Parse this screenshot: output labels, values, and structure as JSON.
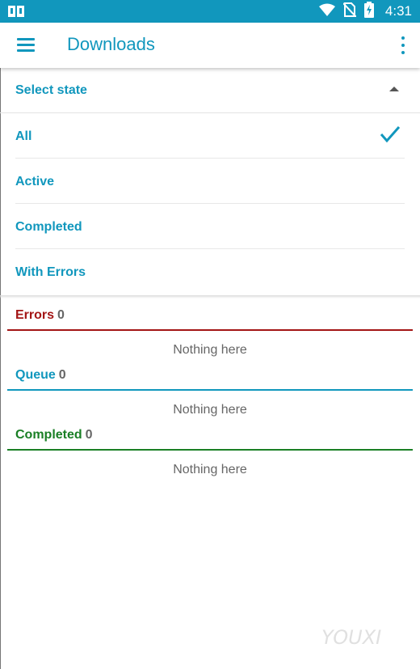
{
  "status_bar": {
    "time": "4:31"
  },
  "app_bar": {
    "title": "Downloads"
  },
  "state_selector": {
    "label": "Select state"
  },
  "state_options": [
    {
      "label": "All",
      "selected": true
    },
    {
      "label": "Active",
      "selected": false
    },
    {
      "label": "Completed",
      "selected": false
    },
    {
      "label": "With Errors",
      "selected": false
    }
  ],
  "sections": [
    {
      "title": "Errors",
      "count": "0",
      "color": "#a31515",
      "empty_text": "Nothing here"
    },
    {
      "title": "Queue",
      "count": "0",
      "color": "#1197bd",
      "empty_text": "Nothing here"
    },
    {
      "title": "Completed",
      "count": "0",
      "color": "#1a7f25",
      "empty_text": "Nothing here"
    }
  ],
  "colors": {
    "accent": "#1197bd",
    "status_bar": "#1197bd"
  }
}
